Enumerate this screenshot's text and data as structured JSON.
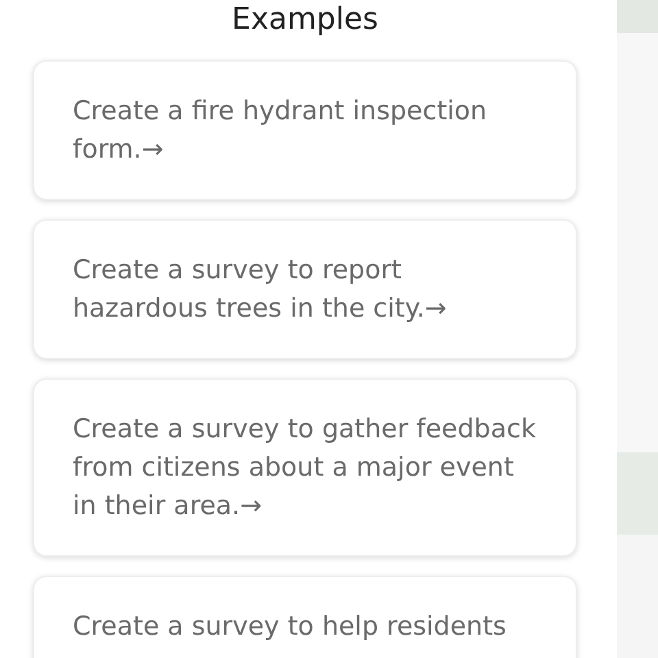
{
  "heading": "Examples",
  "examples": [
    {
      "text": "Create a fire hydrant inspection form.→"
    },
    {
      "text": "Create a survey to report hazardous trees in the city.→"
    },
    {
      "text": "Create a survey to gather feedback from citizens about a major event in their area.→"
    },
    {
      "text": "Create a survey to help residents"
    }
  ]
}
